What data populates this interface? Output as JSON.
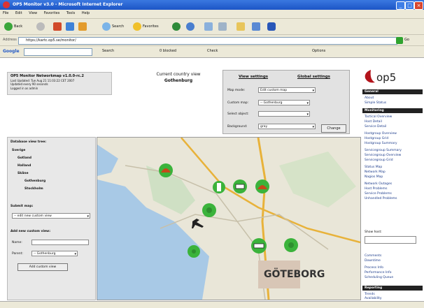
{
  "window": {
    "title": "OP5 Monitor v3.0 - Microsoft Internet Explorer",
    "min": "_",
    "max": "□",
    "close": "×"
  },
  "menu": [
    "File",
    "Edit",
    "View",
    "Favorites",
    "Tools",
    "Help"
  ],
  "toolbar": {
    "back": "Back",
    "search": "Search",
    "favorites": "Favorites"
  },
  "address": {
    "label": "Address",
    "url": "https://kartc.op5.se/monitor/",
    "go": "Go"
  },
  "google": {
    "logo": "Google",
    "search": "Search",
    "blocked": "0 blocked",
    "check": "Check",
    "options": "Options"
  },
  "status_box": {
    "title": "OP5 Monitor Networkmap v1.0.0-rc.2",
    "lines": [
      "Last Updated: Tue Aug 21 11:03:22 CET 2007",
      "Updated every 90 seconds",
      "Logged in as admin"
    ]
  },
  "current": {
    "line1": "Current country view",
    "line2": "Gothenburg"
  },
  "view_settings": {
    "tab1": "View settings",
    "tab2": "Global settings",
    "rows": [
      {
        "label": "Map mode:",
        "value": "Edit custom map"
      },
      {
        "label": "Custom map:",
        "value": "-- Gothenburg"
      },
      {
        "label": "Select object:",
        "value": ""
      },
      {
        "label": "Background:",
        "value": "gray"
      }
    ],
    "change": "Change"
  },
  "left_panel": {
    "title": "Database view tree:",
    "tree": [
      {
        "text": "Sverige",
        "bold": true,
        "indent": 0
      },
      {
        "text": "Gotland",
        "bold": true,
        "indent": 1
      },
      {
        "text": "Halland",
        "bold": true,
        "indent": 1
      },
      {
        "text": "Skåne",
        "bold": true,
        "indent": 1
      },
      {
        "text": "Gothenburg",
        "bold": true,
        "indent": 2
      },
      {
        "text": "Stockholm",
        "bold": true,
        "indent": 2
      }
    ],
    "submit_label": "Submit map:",
    "submit_value": "-- edit new custom view",
    "add_title": "Add new custom view:",
    "name_label": "Name:",
    "parent_label": "Parent:",
    "parent_value": "-- Gothenburg",
    "add_button": "Add custom view"
  },
  "sidebar": {
    "logo": "op5",
    "sections": [
      {
        "title": "General",
        "items": [
          "About",
          "Simple Status"
        ]
      },
      {
        "title": "Monitoring",
        "items": [
          "Tactical Overview",
          "Host Detail",
          "Service Detail",
          "Hostgroup Overview",
          "Hostgroup Grid",
          "Hostgroup Summary",
          "Servicegroup Summary",
          "Servicegroup Overview",
          "Servicegroup Grid",
          "Status Map",
          "Network Map",
          "Nagios Map",
          "Network Outages",
          "Host Problems",
          "Service Problems",
          "Unhandled Problems"
        ]
      },
      {
        "title": "Reporting",
        "items": [
          "Trends",
          "Availability"
        ]
      }
    ],
    "show_host": "Show host:",
    "extra": [
      "Comments",
      "Downtime",
      "Process Info",
      "Performance Info",
      "Scheduling Queue"
    ]
  },
  "map": {
    "markers": [
      {
        "name": "host-status-warning",
        "icon": "warning-icon"
      },
      {
        "name": "host-status-ok",
        "icon": "ok-icon"
      },
      {
        "name": "host-status-pending",
        "icon": "pending-icon"
      },
      {
        "name": "host-status-warning",
        "icon": "warning-icon"
      },
      {
        "name": "host-status-ok",
        "icon": "ok-icon"
      },
      {
        "name": "host-status-ok",
        "icon": "ok-icon"
      },
      {
        "name": "host-status-pending",
        "icon": "pending-icon"
      },
      {
        "name": "host-status-ok",
        "icon": "ok-icon"
      }
    ],
    "colors": {
      "ok": "#3bb33b",
      "warning": "#c44a1a",
      "water": "#a8c9e6",
      "land": "#e9e6d8"
    }
  },
  "status_bar": {
    "text": ""
  }
}
